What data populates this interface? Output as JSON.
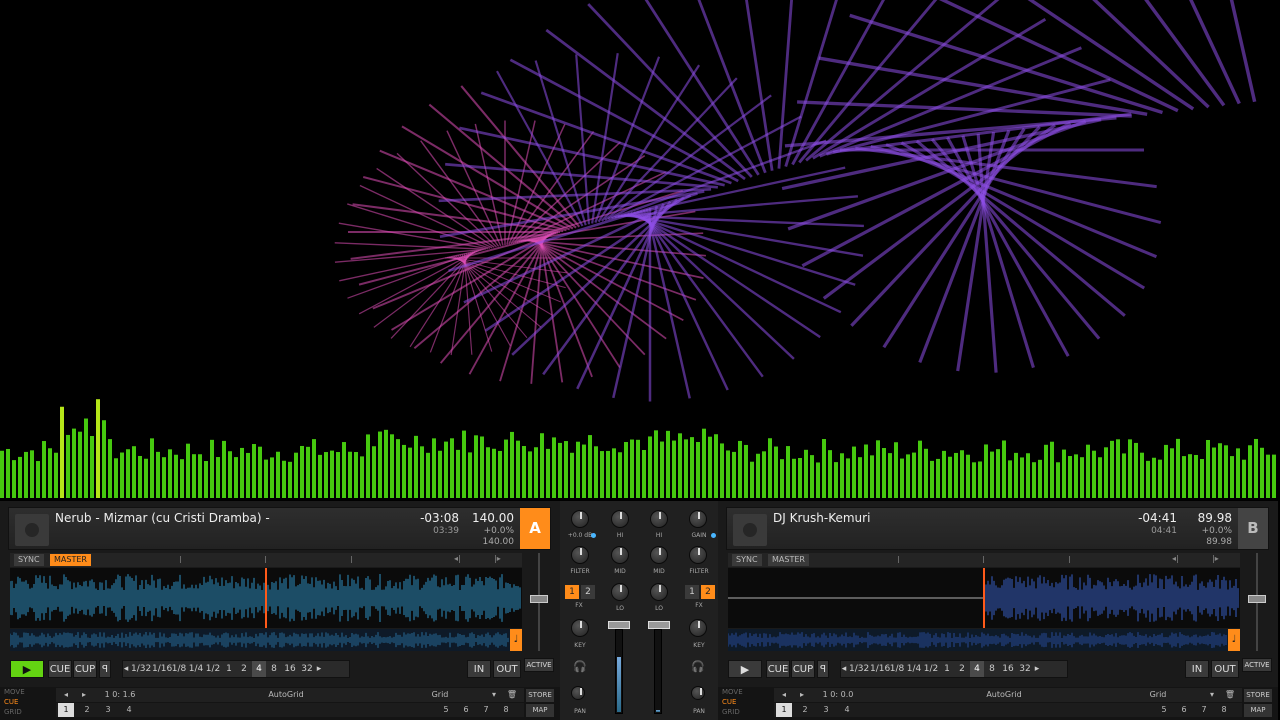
{
  "colors": {
    "accent": "#ff8c1a",
    "play": "#63d312",
    "wave_a": "#35a7e0",
    "wave_b": "#3f6fe8",
    "spectrum": "#5cd413"
  },
  "visualizer": {
    "type": "spectrum-and-spiral",
    "name": "audio-visualizer"
  },
  "deckA": {
    "letter": "A",
    "title": "Nerub - Mizmar (cu Cristi Dramba) -",
    "remaining": "-03:08",
    "elapsed": "03:39",
    "bpm": "140.00",
    "pitch": "+0.0%",
    "bpm_base": "140.00",
    "sync": "SYNC",
    "master": "MASTER",
    "playing": true,
    "play_icon": "▶",
    "cue": "CUE",
    "cup": "CUP",
    "flux": "ꟼ",
    "loops": [
      "1/32",
      "1/16",
      "1/8",
      "1/4",
      "1/2",
      "1",
      "2",
      "4",
      "8",
      "16",
      "32"
    ],
    "selected_loop": "4",
    "in": "IN",
    "out": "OUT",
    "active": "ACTIVE",
    "modes": [
      "MOVE",
      "CUE",
      "GRID"
    ],
    "active_mode": "CUE",
    "position": "1 0: 1.6",
    "cue_name": "AutoGrid",
    "cue_type": "Grid",
    "store": "STORE",
    "map": "MAP",
    "hotcues_low": [
      "1",
      "2",
      "3",
      "4"
    ],
    "hotcues_high": [
      "5",
      "6",
      "7",
      "8"
    ]
  },
  "deckB": {
    "letter": "B",
    "title": "DJ Krush-Kemuri",
    "remaining": "-04:41",
    "elapsed": "04:41",
    "bpm": "89.98",
    "pitch": "+0.0%",
    "bpm_base": "89.98",
    "sync": "SYNC",
    "master": "MASTER",
    "playing": false,
    "play_icon": "▶",
    "cue": "CUE",
    "cup": "CUP",
    "flux": "ꟼ",
    "loops": [
      "1/32",
      "1/16",
      "1/8",
      "1/4",
      "1/2",
      "1",
      "2",
      "4",
      "8",
      "16",
      "32"
    ],
    "selected_loop": "4",
    "in": "IN",
    "out": "OUT",
    "active": "ACTIVE",
    "modes": [
      "MOVE",
      "CUE",
      "GRID"
    ],
    "active_mode": "CUE",
    "position": "1 0: 0.0",
    "cue_name": "AutoGrid",
    "cue_type": "Grid",
    "store": "STORE",
    "map": "MAP",
    "hotcues_low": [
      "1",
      "2",
      "3",
      "4"
    ],
    "hotcues_high": [
      "5",
      "6",
      "7",
      "8"
    ]
  },
  "mixer": {
    "gain_left": "+0.0 dB",
    "hi": "HI",
    "mid": "MID",
    "lo": "LO",
    "filter": "FILTER",
    "gain": "GAIN",
    "fx": "FX",
    "key": "KEY",
    "pan": "PAN",
    "fx_buttons": [
      "1",
      "2"
    ]
  }
}
